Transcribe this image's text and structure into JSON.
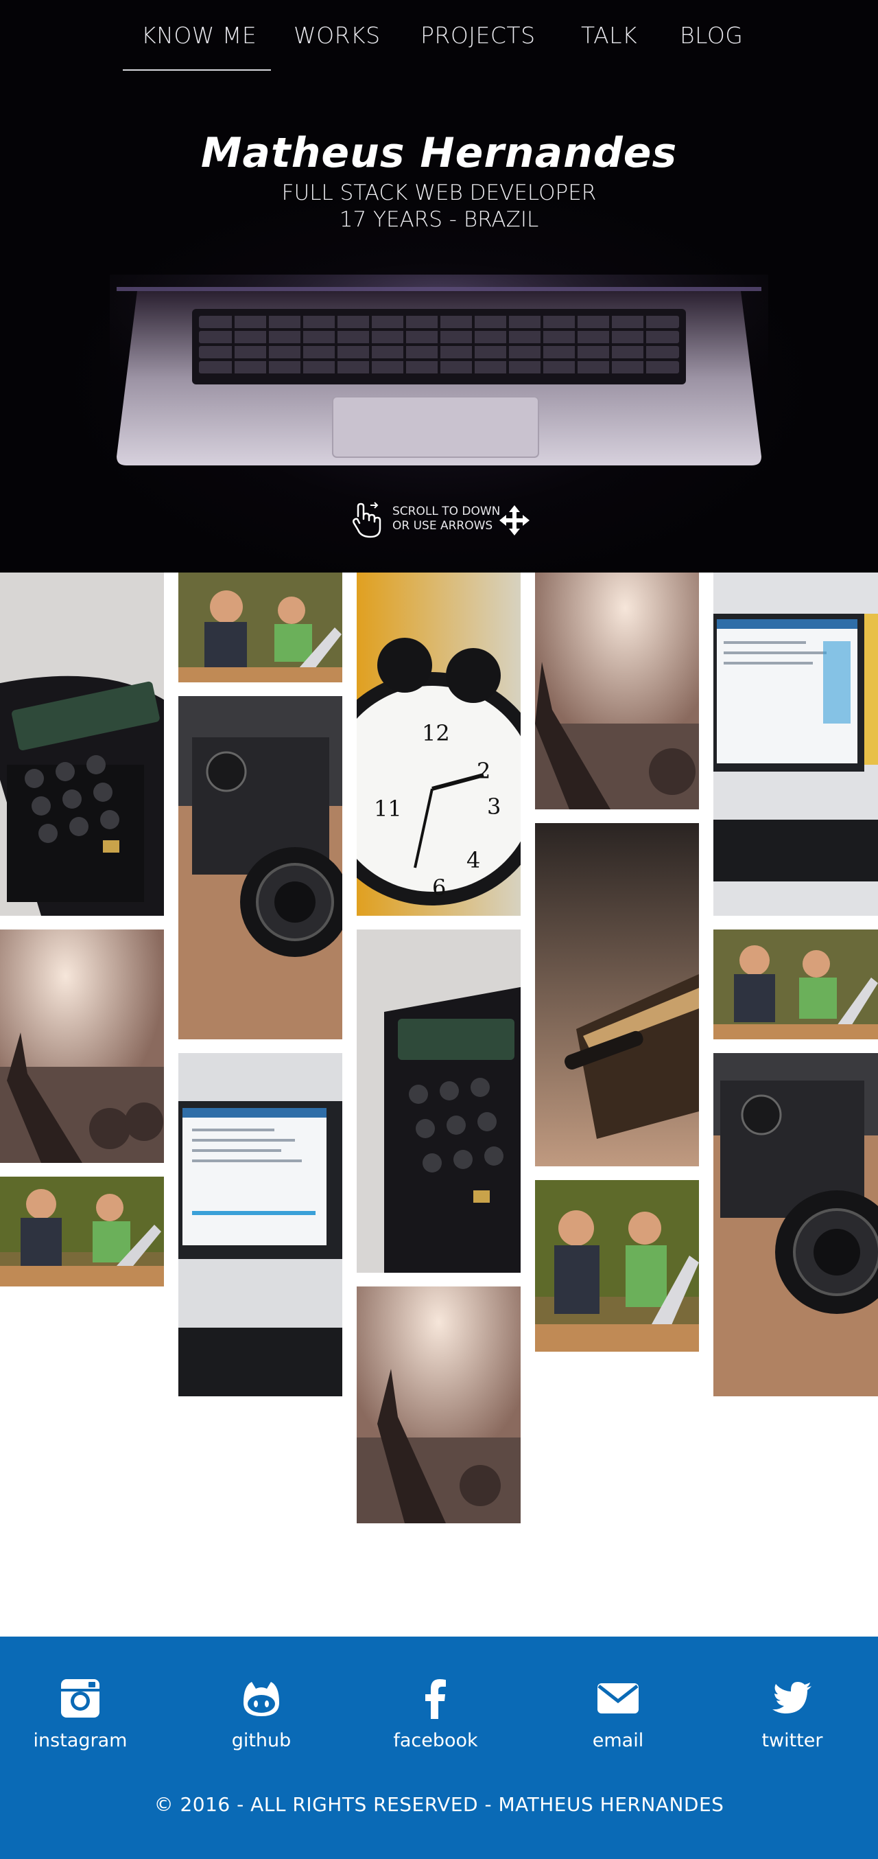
{
  "nav": {
    "items": [
      {
        "label": "KNOW ME",
        "active": true
      },
      {
        "label": "WORKS"
      },
      {
        "label": "PROJECTS"
      },
      {
        "label": "TALK"
      },
      {
        "label": "BLOG"
      }
    ]
  },
  "hero": {
    "name": "Matheus Hernandes",
    "role": "FULL STACK WEB DEVELOPER",
    "age_location": "17 YEARS - BRAZIL",
    "scroll_hint_line1": "SCROLL TO DOWN",
    "scroll_hint_line2": "OR USE ARROWS"
  },
  "gallery": {
    "photos": [
      "calculator",
      "kids-laptop",
      "camera",
      "alarm-clock",
      "concert-hand",
      "desktop-computer",
      "book-pen"
    ]
  },
  "footer": {
    "social": [
      {
        "label": "instagram",
        "icon": "instagram-icon"
      },
      {
        "label": "github",
        "icon": "github-icon"
      },
      {
        "label": "facebook",
        "icon": "facebook-icon"
      },
      {
        "label": "email",
        "icon": "email-icon"
      },
      {
        "label": "twitter",
        "icon": "twitter-icon"
      }
    ],
    "copyright": "© 2016 - ALL RIGHTS RESERVED - MATHEUS HERNANDES"
  },
  "colors": {
    "footer_bg": "#0a6ab6",
    "hero_bg": "#050308"
  }
}
